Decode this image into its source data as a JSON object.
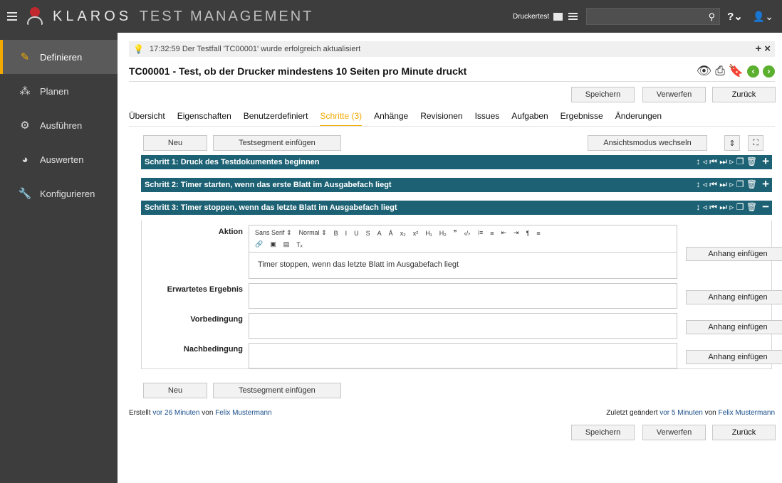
{
  "header": {
    "app_title_a": "KLAROS",
    "app_title_b": "TEST MANAGEMENT",
    "project": "Druckertest",
    "help": "?⌄",
    "user": "⌄"
  },
  "sidebar": {
    "items": [
      {
        "label": "Definieren",
        "icon": "edit-icon"
      },
      {
        "label": "Planen",
        "icon": "people-icon"
      },
      {
        "label": "Ausführen",
        "icon": "gear-icon"
      },
      {
        "label": "Auswerten",
        "icon": "pie-chart-icon"
      },
      {
        "label": "Konfigurieren",
        "icon": "wrench-icon"
      }
    ]
  },
  "notice": {
    "text": "17:32:59 Der Testfall 'TC00001' wurde erfolgreich aktualisiert",
    "actions": "+ ×"
  },
  "testcase": {
    "title": "TC00001 - Test, ob der Drucker mindestens 10 Seiten pro Minute druckt"
  },
  "buttons": {
    "save": "Speichern",
    "discard": "Verwerfen",
    "back": "Zurück",
    "new": "Neu",
    "insert_segment": "Testsegment einfügen",
    "switch_view": "Ansichtsmodus wechseln",
    "attach": "Anhang einfügen"
  },
  "tabs": [
    "Übersicht",
    "Eigenschaften",
    "Benutzerdefiniert",
    "Schritte (3)",
    "Anhänge",
    "Revisionen",
    "Issues",
    "Aufgaben",
    "Ergebnisse",
    "Änderungen"
  ],
  "steps": [
    {
      "title": "Schritt 1: Druck des Testdokumentes beginnen",
      "toggle": "+"
    },
    {
      "title": "Schritt 2: Timer starten, wenn das erste Blatt im Ausgabefach liegt",
      "toggle": "+"
    },
    {
      "title": "Schritt 3: Timer stoppen, wenn das letzte Blatt im Ausgabefach liegt",
      "toggle": "−"
    }
  ],
  "step_tools": "↕ ◃ ⏮ ⏭ ▹ ❐ 🗑",
  "step3": {
    "labels": {
      "action": "Aktion",
      "expected": "Erwartetes Ergebnis",
      "precondition": "Vorbedingung",
      "postcondition": "Nachbedingung"
    },
    "action_text": "Timer stoppen, wenn das letzte Blatt im Ausgabefach liegt",
    "toolbar_row1": [
      "Sans Serif ⇕",
      "Normal ⇕",
      "B",
      "I",
      "U",
      "S",
      "A",
      "Ā",
      "x₂",
      "x²",
      "H₁",
      "H₂",
      "❞",
      "‹/›",
      "⁝≡",
      "≡",
      "⇤",
      "⇥",
      "¶",
      "≡"
    ],
    "toolbar_row2": [
      "🔗",
      "▣",
      "▤",
      "Tₓ"
    ]
  },
  "footer": {
    "created_prefix": "Erstellt",
    "created_time": "vor 26 Minuten",
    "created_by_prefix": "von",
    "created_by": "Felix Mustermann",
    "changed_prefix": "Zuletzt geändert",
    "changed_time": "vor 5 Minuten",
    "changed_by_prefix": "von",
    "changed_by": "Felix Mustermann"
  }
}
